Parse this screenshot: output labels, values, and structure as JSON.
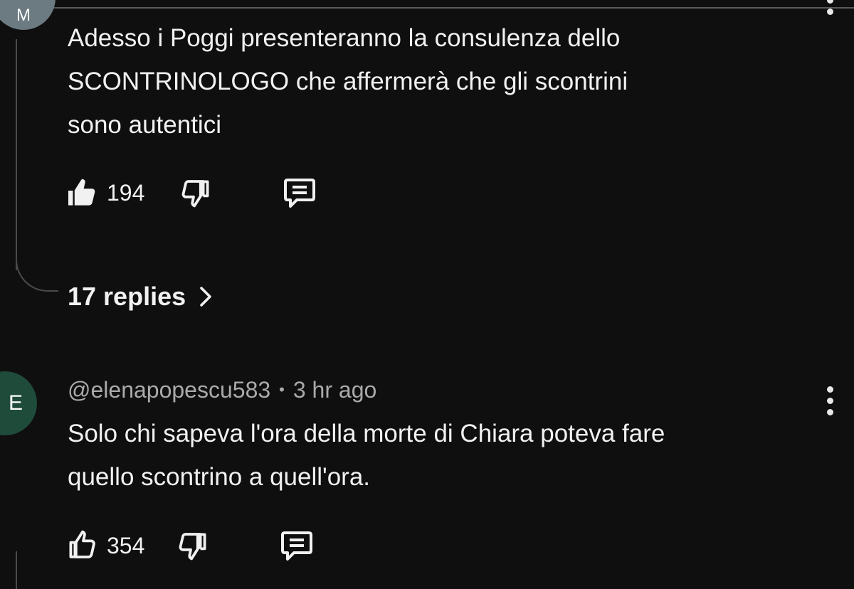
{
  "comment_1": {
    "avatar_letter": "M",
    "text": "Adesso i Poggi presenteranno la consulenza dello\nSCONTRINOLOGO che affermerà che gli scontrini\nsono autentici",
    "likes": "194",
    "replies_label": "17 replies"
  },
  "comment_2": {
    "avatar_letter": "E",
    "author": "@elenapopescu583",
    "separator": "•",
    "time": "3 hr ago",
    "text": "Solo chi sapeva l'ora della morte di Chiara poteva fare\nquello scontrino a quell'ora.",
    "likes": "354"
  },
  "icons": {
    "like_filled": "thumbs-up-filled-icon",
    "like_outline": "thumbs-up-outline-icon",
    "dislike": "thumbs-down-icon",
    "reply": "comment-reply-icon",
    "more": "more-vertical-icon",
    "chevron": "chevron-right-icon"
  },
  "colors": {
    "background": "#0f0f0f",
    "text": "#f1f1f1",
    "meta_text": "#aaaaaa",
    "avatar_e": "#1f4b3b",
    "avatar_m": "#6c7a82"
  }
}
